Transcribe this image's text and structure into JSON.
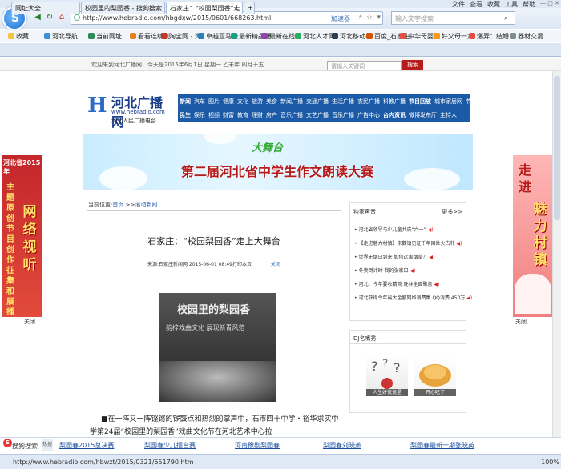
{
  "menu": [
    "文件",
    "查看",
    "收藏",
    "工具",
    "帮助"
  ],
  "browser": {
    "url": "http://www.hebradio.com/hbgdxw/2015/0601/668263.html",
    "accelerate": "加速器",
    "search_placeholder": "输入文字搜索"
  },
  "favorites": [
    "收藏",
    "河北导航",
    "当前网址",
    "看看连续剧",
    "淘宝网 - 淘",
    "卓越亚马逊",
    "最新精品硬",
    "最新在线小",
    "河北人才网",
    "河北移动—",
    "百度_石家庄",
    "中华母婴教",
    "好父母一定",
    "爆弄：结婚",
    "器材交易"
  ],
  "tabs": [
    "网址大全",
    "校园里的梨园香 - 搜狗搜索",
    "石家庄：\"校园梨园香\"走"
  ],
  "site": {
    "welcome": "欢迎来到河北广播网，今天是2015年6月1日 星期一 乙未年 四月十五",
    "search_placeholder": "请输入关键词",
    "search_button": "搜索",
    "brand_cn": "河北广播网",
    "brand_en": "www.hebradio.com",
    "brand_sub": "河北人民广播电台",
    "nav_row1": [
      "新闻",
      "汽车",
      "图片",
      "健康",
      "文化",
      "旅游",
      "美食",
      "新闻广播",
      "交通广播",
      "生活广播",
      "农民广播",
      "科教广播",
      "节目回放",
      "城市家居网",
      "节目表"
    ],
    "nav_row2": [
      "民生",
      "娱乐",
      "视频",
      "财富",
      "教育",
      "理财",
      "房产",
      "音乐广播",
      "文艺广播",
      "音乐广播",
      "广告中心",
      "台内资讯",
      "微博发布厅",
      "主持人"
    ],
    "banner_title": "第二届河北省中学生作文朗读大赛",
    "banner_logo": "大舞台"
  },
  "left_ad": {
    "head": "河北省2015年",
    "vertical": "主题原创节目创作征集和展播",
    "big": "网络视听"
  },
  "right_ad": {
    "vertical": "走进",
    "big": "魅力村镇"
  },
  "ad_close": "关闭",
  "breadcrumb": {
    "prefix": "当前位置:",
    "home": "首页",
    "sep": ">>",
    "section": "滚动新闻"
  },
  "article": {
    "title": "石家庄：“校园梨园香”走上大舞台",
    "meta": "来源:石家庄新闻网 2015-06-01 08:49打印本页",
    "close": "关闭",
    "photo_text": "校园里的梨园香",
    "photo_sub": "韵梓戏曲文化   展现新青风范",
    "paragraph": "■在一阵又一阵铿锵的锣鼓点和热烈的掌声中，石市四十中学・裕华求实中学第24届“校园里的梨园香”戏曲文化节在河北艺术中心拉"
  },
  "sidebar": {
    "title": "独家声音",
    "more": "更多>>",
    "items": [
      "河北省领导与少儿童共庆“六一”",
      "【走进魅力村镇】来魏镇见证千年国灶火古朴",
      "世界无烟日到来 如何远离烟草？",
      "冬奥倒计时 我的张家口",
      "河北：今年要收精简 晚林全面聚焦",
      "河北获得今年最大金额网络消费集 QQ消费 450万"
    ]
  },
  "dj": {
    "title": "DJ名嘴秀",
    "tiles": [
      "人生好侃侃星",
      "开心吃了"
    ]
  },
  "sougou": {
    "label": "搜狗搜索",
    "badge": "热搜",
    "links": [
      "梨园春2015总决赛",
      "梨园春少儿擂台赛",
      "河南豫剧梨园春",
      "梨园春刘晓燕",
      "梨园春最新一期张晓英"
    ]
  },
  "status": {
    "url": "http://www.hebradio.com/hbwzt/2015/0321/651790.htm",
    "zoom": "100%"
  }
}
